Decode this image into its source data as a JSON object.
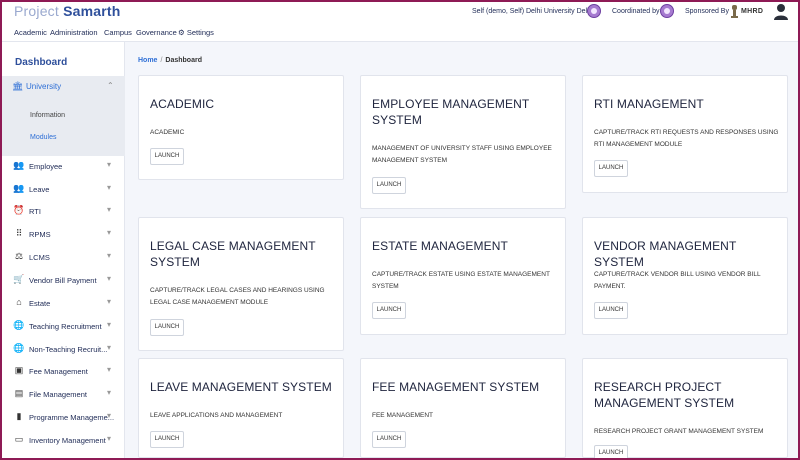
{
  "header": {
    "brand_first": "Project",
    "brand_second": "Samarth",
    "role": "Self (demo, Self)",
    "university": "Delhi University Delhi",
    "coordinated_by": "Coordinated by",
    "sponsored_by": "Sponsored By",
    "sponsor_name": "MHRD"
  },
  "nav": {
    "items": [
      "Academic",
      "Administration",
      "Campus",
      "Governance",
      "Settings"
    ],
    "settings_icon": "gear-icon"
  },
  "sidebar": {
    "title": "Dashboard",
    "active": {
      "label": "University",
      "icon": "university-icon"
    },
    "sub_items": [
      {
        "label": "Information",
        "color": "#444444"
      },
      {
        "label": "Modules",
        "color": "#2e6fd6"
      }
    ],
    "items": [
      {
        "label": "Employee",
        "icon": "users-icon"
      },
      {
        "label": "Leave",
        "icon": "users-icon"
      },
      {
        "label": "RTI",
        "icon": "alarm-icon"
      },
      {
        "label": "RPMS",
        "icon": "grid-icon"
      },
      {
        "label": "LCMS",
        "icon": "gavel-icon"
      },
      {
        "label": "Vendor Bill Payment",
        "icon": "cart-icon"
      },
      {
        "label": "Estate",
        "icon": "home-icon"
      },
      {
        "label": "Teaching Recruitment",
        "icon": "globe-icon"
      },
      {
        "label": "Non-Teaching Recruit...",
        "icon": "globe-icon"
      },
      {
        "label": "Fee Management",
        "icon": "money-icon"
      },
      {
        "label": "File Management",
        "icon": "folder-icon"
      },
      {
        "label": "Programme Manageme...",
        "icon": "book-icon"
      },
      {
        "label": "Inventory Management",
        "icon": "briefcase-icon"
      }
    ]
  },
  "breadcrumb": {
    "home": "Home",
    "separator": "/",
    "current": "Dashboard"
  },
  "cards": [
    {
      "title": "ACADEMIC",
      "description": "ACADEMIC",
      "button": "LAUNCH"
    },
    {
      "title": "EMPLOYEE MANAGEMENT SYSTEM",
      "description": "MANAGEMENT OF UNIVERSITY STAFF USING EMPLOYEE MANAGEMENT SYSTEM",
      "button": "LAUNCH"
    },
    {
      "title": "RTI MANAGEMENT",
      "description": "CAPTURE/TRACK RTI REQUESTS AND RESPONSES USING RTI MANAGEMENT MODULE",
      "button": "LAUNCH"
    },
    {
      "title": "LEGAL CASE MANAGEMENT SYSTEM",
      "description": "CAPTURE/TRACK LEGAL CASES AND HEARINGS USING LEGAL CASE MANAGEMENT MODULE",
      "button": "LAUNCH"
    },
    {
      "title": "ESTATE MANAGEMENT",
      "description": "CAPTURE/TRACK ESTATE USING ESTATE MANAGEMENT SYSTEM",
      "button": "LAUNCH"
    },
    {
      "title": "VENDOR MANAGEMENT SYSTEM",
      "description": "CAPTURE/TRACK VENDOR BILL USING VENDOR BILL PAYMENT.",
      "button": "LAUNCH"
    },
    {
      "title": "LEAVE MANAGEMENT SYSTEM",
      "description": "LEAVE APPLICATIONS AND MANAGEMENT",
      "button": "LAUNCH"
    },
    {
      "title": "FEE MANAGEMENT SYSTEM",
      "description": "FEE MANAGEMENT",
      "button": "LAUNCH"
    },
    {
      "title": "RESEARCH PROJECT MANAGEMENT SYSTEM",
      "description": "RESEARCH PROJECT GRANT MANAGEMENT SYSTEM",
      "button": "LAUNCH"
    }
  ],
  "colors": {
    "frame": "#8e1a55",
    "brand": "#2e4f9b",
    "accent": "#2e6fd6",
    "background": "#f4f6fb"
  }
}
